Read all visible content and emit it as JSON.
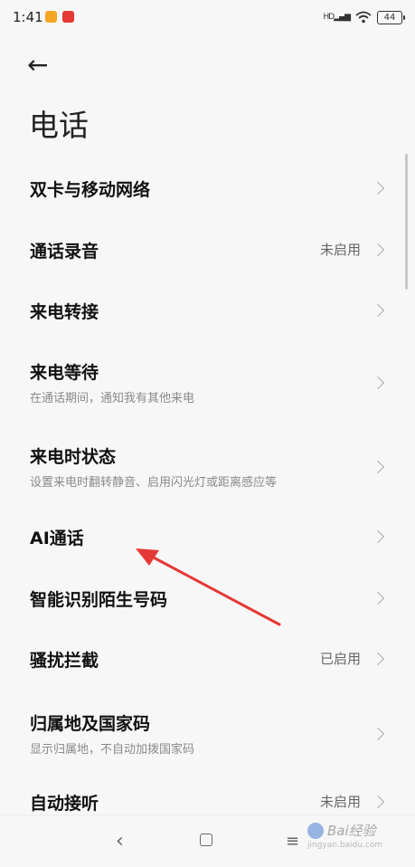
{
  "status_bar": {
    "time": "1:41",
    "signal_label": "HD",
    "battery": "44"
  },
  "header": {
    "back_glyph": "←",
    "title": "电话"
  },
  "items": [
    {
      "label": "双卡与移动网络",
      "sub": "",
      "status": ""
    },
    {
      "label": "通话录音",
      "sub": "",
      "status": "未启用"
    },
    {
      "label": "来电转接",
      "sub": "",
      "status": ""
    },
    {
      "label": "来电等待",
      "sub": "在通话期间，通知我有其他来电",
      "status": ""
    },
    {
      "label": "来电时状态",
      "sub": "设置来电时翻转静音、启用闪光灯或距离感应等",
      "status": ""
    },
    {
      "label": "AI通话",
      "sub": "",
      "status": ""
    },
    {
      "label": "智能识别陌生号码",
      "sub": "",
      "status": ""
    },
    {
      "label": "骚扰拦截",
      "sub": "",
      "status": "已启用"
    },
    {
      "label": "归属地及国家码",
      "sub": "显示归属地，不自动加拨国家码",
      "status": ""
    },
    {
      "label": "自动接听",
      "sub": "",
      "status": "未启用"
    }
  ],
  "nav": {
    "back_glyph": "‹",
    "menu_glyph": "≡"
  },
  "watermark": {
    "text": "Bai经验",
    "url": "jingyan.baidu.com"
  },
  "colors": {
    "annotation_arrow": "#e53935",
    "background": "#f7f7f7"
  }
}
